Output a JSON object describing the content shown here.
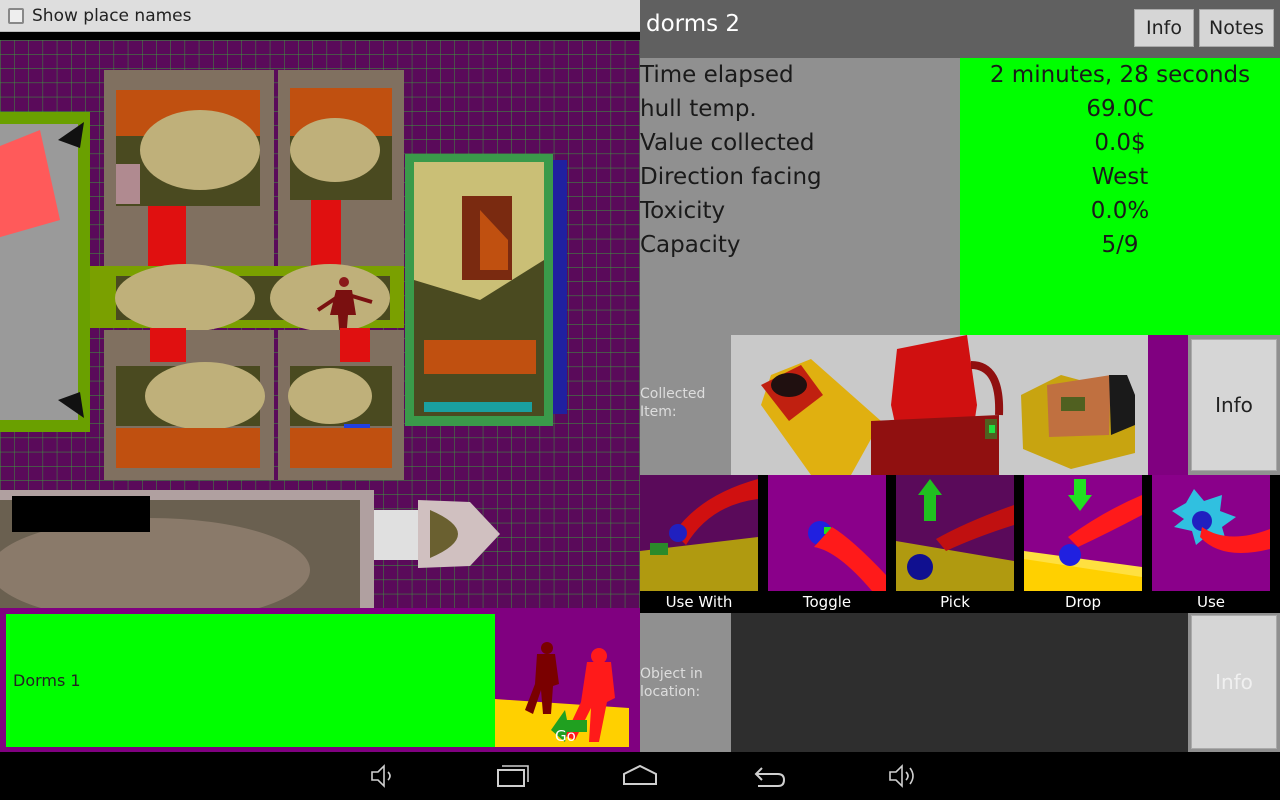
{
  "map_panel": {
    "show_place_names_label": "Show place names",
    "show_place_names_checked": false,
    "current_location": "Dorms 1",
    "go_label": "Go"
  },
  "header": {
    "title": "dorms 2",
    "info_label": "Info",
    "notes_label": "Notes"
  },
  "stats": [
    {
      "label": "Time elapsed",
      "value": "2 minutes, 28 seconds"
    },
    {
      "label": "hull temp.",
      "value": "69.0C"
    },
    {
      "label": "Value collected",
      "value": "0.0$"
    },
    {
      "label": "Direction facing",
      "value": "West"
    },
    {
      "label": "Toxicity",
      "value": "0.0%"
    },
    {
      "label": "Capacity",
      "value": "5/9"
    }
  ],
  "collected": {
    "label_line1": "Collected",
    "label_line2": "Item:",
    "info_label": "Info"
  },
  "actions": [
    {
      "label": "Use With"
    },
    {
      "label": "Toggle"
    },
    {
      "label": "Pick"
    },
    {
      "label": "Drop"
    },
    {
      "label": "Use"
    }
  ],
  "object_in_location": {
    "label_line1": "Object in",
    "label_line2": "location:",
    "info_label": "Info"
  },
  "colors": {
    "green": "#00ff00",
    "purple": "#800080",
    "panel_gray": "#909090"
  },
  "icons": {
    "nav": [
      "volume-down-icon",
      "recent-apps-icon",
      "home-icon",
      "back-icon",
      "volume-up-icon"
    ]
  }
}
